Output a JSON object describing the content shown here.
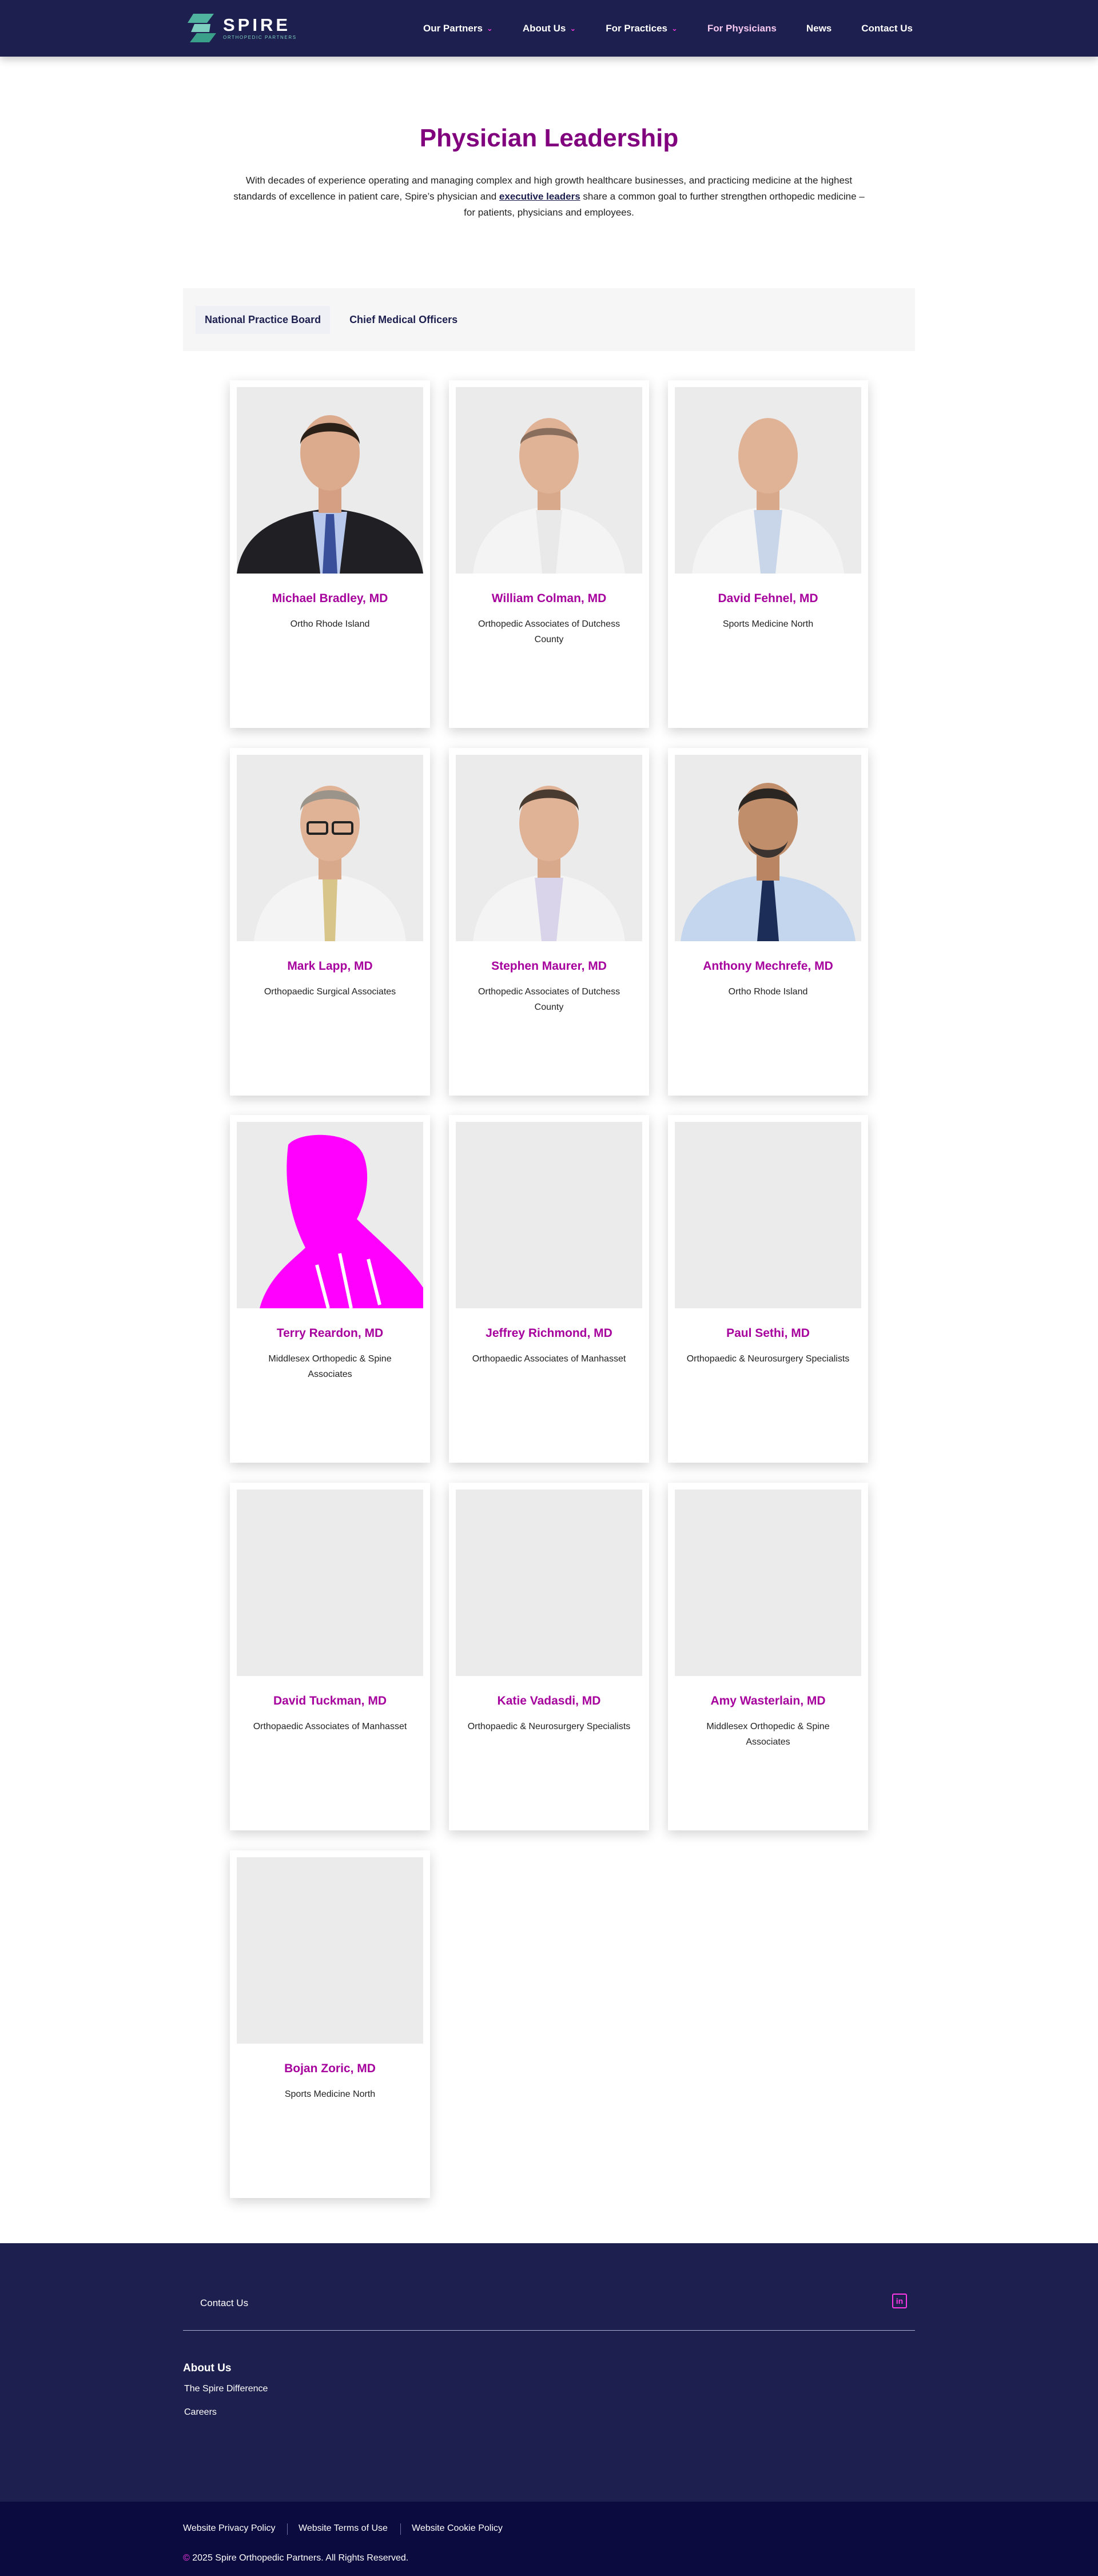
{
  "header": {
    "logo": {
      "name": "SPIRE",
      "subtitle": "ORTHOPEDIC PARTNERS"
    },
    "nav": [
      {
        "label": "Our Partners",
        "has_dropdown": true
      },
      {
        "label": "About Us",
        "has_dropdown": true
      },
      {
        "label": "For Practices",
        "has_dropdown": true
      },
      {
        "label": "For Physicians",
        "has_dropdown": false
      },
      {
        "label": "News",
        "has_dropdown": false
      },
      {
        "label": "Contact Us",
        "has_dropdown": false
      }
    ]
  },
  "intro": {
    "title": "Physician Leadership",
    "text_before_link": "With decades of experience operating and managing complex and high growth healthcare businesses, and practicing medicine at the highest standards of excellence in patient care, Spire’s physician and ",
    "link_text": "executive leaders",
    "text_after_link": " share a common goal to further strengthen orthopedic medicine – for patients, physicians and employees."
  },
  "tabs": [
    {
      "label": "National Practice Board",
      "active": true
    },
    {
      "label": "Chief Medical Officers",
      "active": false
    }
  ],
  "physicians": [
    {
      "name": "Michael Bradley, MD",
      "practice": "Ortho Rhode Island"
    },
    {
      "name": "William Colman, MD",
      "practice": "Orthopedic Associates of Dutchess County"
    },
    {
      "name": "David Fehnel, MD",
      "practice": "Sports Medicine North"
    },
    {
      "name": "Mark Lapp, MD",
      "practice": "Orthopaedic Surgical Associates"
    },
    {
      "name": "Stephen Maurer, MD",
      "practice": "Orthopedic Associates of Dutchess County"
    },
    {
      "name": "Anthony Mechrefe, MD",
      "practice": "Ortho Rhode Island"
    },
    {
      "name": "Terry Reardon, MD",
      "practice": "Middlesex Orthopedic & Spine Associates"
    },
    {
      "name": "Jeffrey Richmond, MD",
      "practice": "Orthopaedic Associates of Manhasset"
    },
    {
      "name": "Paul Sethi, MD",
      "practice": "Orthopaedic & Neurosurgery Specialists"
    },
    {
      "name": "David Tuckman, MD",
      "practice": "Orthopaedic Associates of Manhasset"
    },
    {
      "name": "Katie Vadasdi, MD",
      "practice": "Orthopaedic & Neurosurgery Specialists"
    },
    {
      "name": "Amy Wasterlain, MD",
      "practice": "Middlesex Orthopedic & Spine Associates"
    },
    {
      "name": "Bojan Zoric, MD",
      "practice": "Sports Medicine North"
    }
  ],
  "footer": {
    "contact_label": "Contact Us",
    "social_icon": "linkedin-icon",
    "social_glyph": "in",
    "about_heading": "About Us",
    "about_links": [
      "The Spire Difference",
      "Careers"
    ],
    "legal_links": [
      "Website Privacy Policy",
      "Website Terms of Use",
      "Website Cookie Policy"
    ],
    "copyright_symbol": "©",
    "copyright": " 2025 Spire Orthopedic Partners. All Rights Reserved."
  },
  "colors": {
    "navy": "#1d1f4f",
    "dark_navy": "#0b0b40",
    "title_purple": "#80007e",
    "name_magenta": "#a6009d",
    "accent_pink": "#ff39e6",
    "logo_teal": "#7fcfc0"
  }
}
